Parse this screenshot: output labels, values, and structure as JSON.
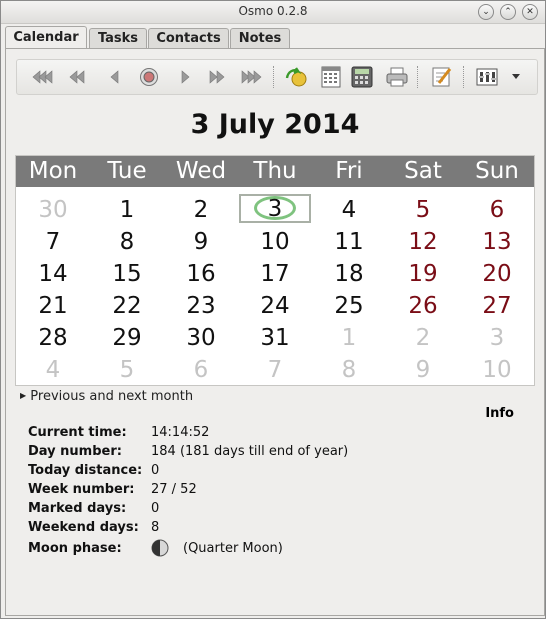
{
  "window": {
    "title": "Osmo 0.2.8",
    "buttons": [
      "chevron-down-icon",
      "chevron-up-icon",
      "close-icon"
    ]
  },
  "tabs": [
    {
      "label": "Calendar",
      "active": true
    },
    {
      "label": "Tasks",
      "active": false
    },
    {
      "label": "Contacts",
      "active": false
    },
    {
      "label": "Notes",
      "active": false
    }
  ],
  "toolbar": {
    "icons": [
      "previous-year-icon",
      "previous-month-icon",
      "previous-day-icon",
      "today-icon",
      "next-day-icon",
      "next-month-icon",
      "next-year-icon",
      "jump-to-date-icon",
      "full-year-calendar-icon",
      "date-calculator-icon",
      "print-icon",
      "edit-note-icon",
      "preferences-icon",
      "menu-dropdown-icon"
    ]
  },
  "calendar": {
    "title": "3 July 2014",
    "weekdays": [
      "Mon",
      "Tue",
      "Wed",
      "Thu",
      "Fri",
      "Sat",
      "Sun"
    ],
    "weeks": [
      [
        "30",
        "1",
        "2",
        "3",
        "4",
        "5",
        "6"
      ],
      [
        "7",
        "8",
        "9",
        "10",
        "11",
        "12",
        "13"
      ],
      [
        "14",
        "15",
        "16",
        "17",
        "18",
        "19",
        "20"
      ],
      [
        "21",
        "22",
        "23",
        "24",
        "25",
        "26",
        "27"
      ],
      [
        "28",
        "29",
        "30",
        "31",
        "1",
        "2",
        "3"
      ],
      [
        "4",
        "5",
        "6",
        "7",
        "8",
        "9",
        "10"
      ]
    ],
    "other_month": [
      [
        0,
        0
      ],
      [
        4,
        4
      ],
      [
        4,
        5
      ],
      [
        4,
        6
      ],
      [
        5,
        0
      ],
      [
        5,
        1
      ],
      [
        5,
        2
      ],
      [
        5,
        3
      ],
      [
        5,
        4
      ],
      [
        5,
        5
      ],
      [
        5,
        6
      ]
    ],
    "today": [
      0,
      3
    ],
    "colors": {
      "weekday": "#111111",
      "weekend": "#7a0d16",
      "other_month": "#c4c4c4",
      "header_bg": "#7a7a7a",
      "today_ring": "#7fc37f"
    }
  },
  "prevnext": {
    "label": "Previous and next month"
  },
  "info": {
    "heading": "Info",
    "rows": [
      {
        "key": "Current time:",
        "value": "14:14:52"
      },
      {
        "key": "Day number:",
        "value": "184  (181 days till end of year)"
      },
      {
        "key": "Today distance:",
        "value": "0"
      },
      {
        "key": "Week number:",
        "value": "27 / 52"
      },
      {
        "key": "Marked days:",
        "value": "0"
      },
      {
        "key": "Weekend days:",
        "value": "8"
      },
      {
        "key": "Moon phase:",
        "value": "(Quarter Moon)"
      }
    ]
  }
}
